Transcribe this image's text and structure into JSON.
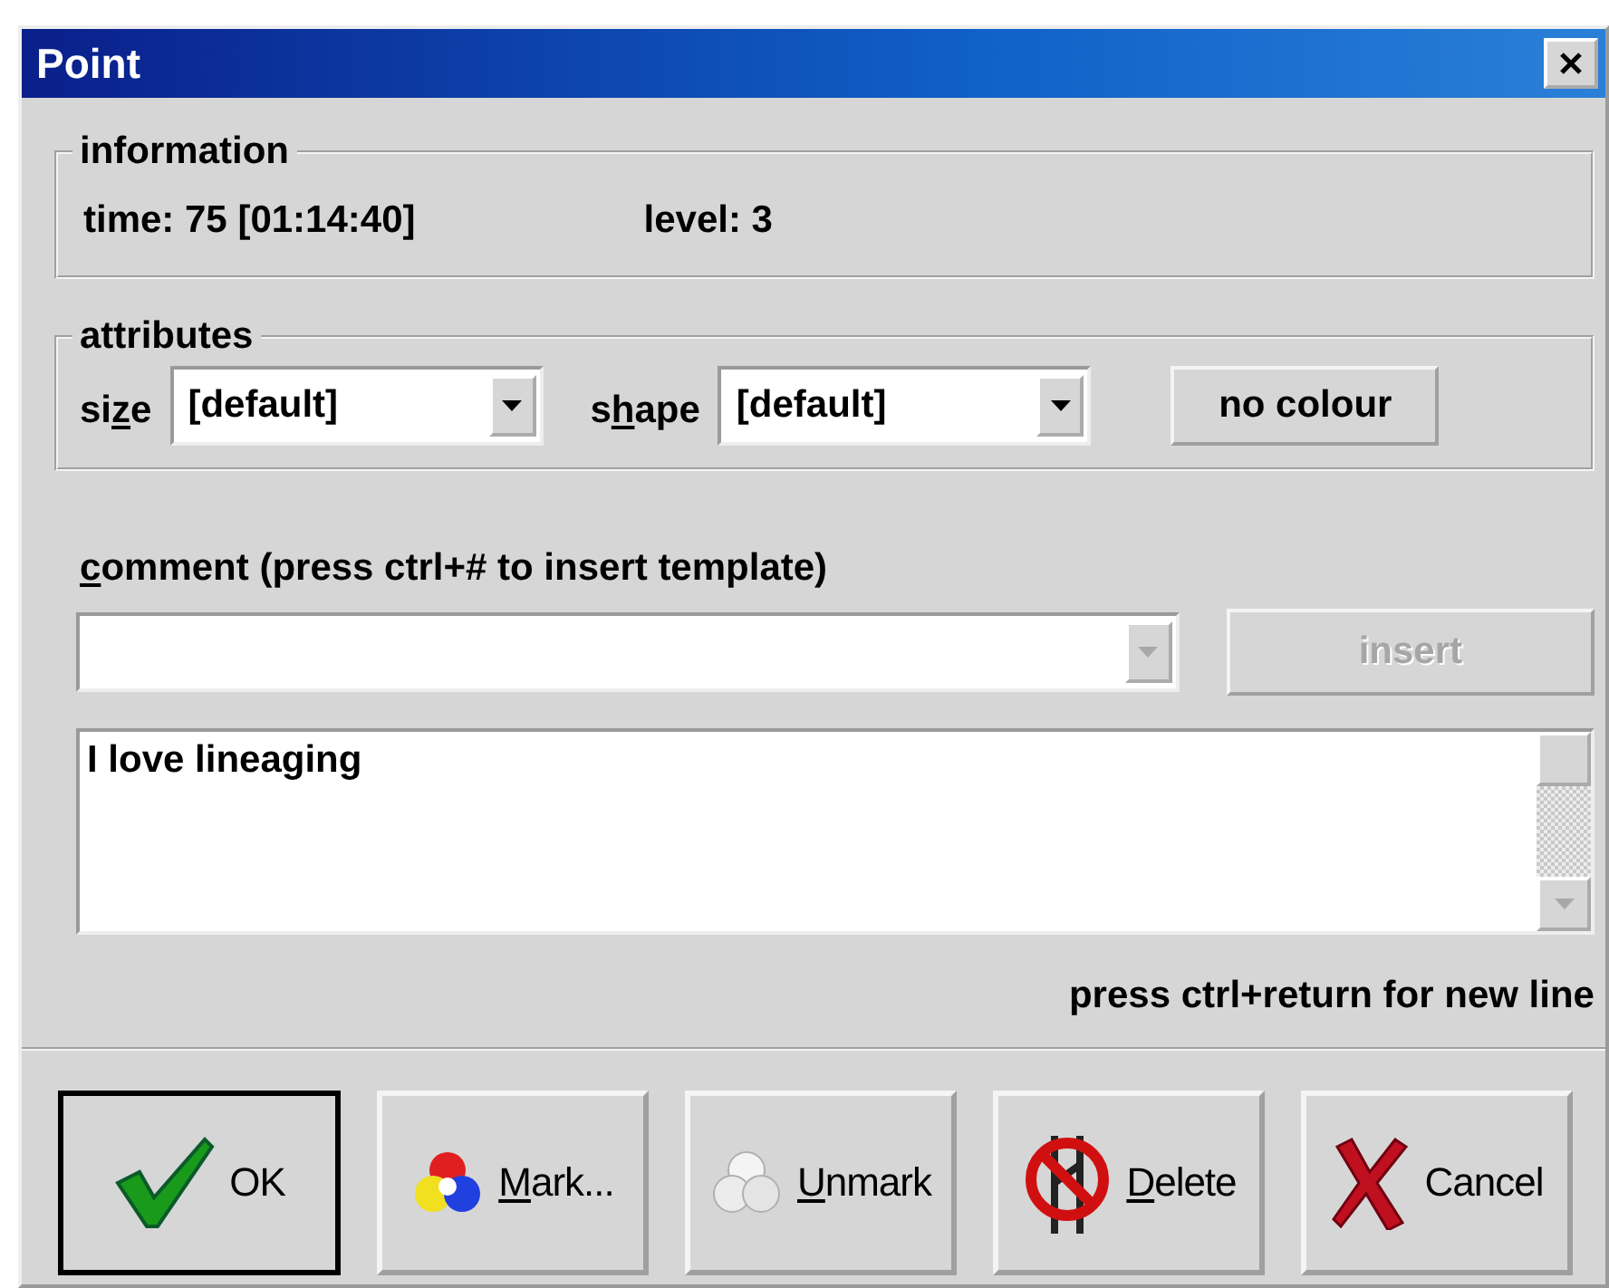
{
  "window": {
    "title": "Point"
  },
  "information": {
    "legend": "information",
    "fields": [
      "time: 75 [01:14:40]",
      "level: 3"
    ]
  },
  "attributes": {
    "legend": "attributes",
    "dropdowns": [
      {
        "label": {
          "pre": "si",
          "key": "z",
          "post": "e"
        },
        "value": "[default]"
      },
      {
        "label": {
          "pre": "s",
          "key": "h",
          "post": "ape"
        },
        "value": "[default]"
      }
    ],
    "colour_button": "no colour"
  },
  "comment": {
    "label": {
      "key": "c",
      "post": "omment (press ctrl+# to insert template)"
    },
    "template_disabled": true,
    "insert_button": {
      "label": "insert",
      "disabled": true
    },
    "text": "I love lineaging",
    "hint": "press ctrl+return for new line"
  },
  "buttons": [
    {
      "kind": "ok",
      "label": {
        "post": "OK"
      },
      "default": true
    },
    {
      "kind": "mark",
      "label": {
        "key": "M",
        "post": "ark..."
      },
      "default": false
    },
    {
      "kind": "unmark",
      "label": {
        "key": "U",
        "post": "nmark"
      },
      "default": false
    },
    {
      "kind": "delete",
      "label": {
        "key": "D",
        "post": "elete"
      },
      "default": false
    },
    {
      "kind": "cancel",
      "label": {
        "post": "Cancel"
      },
      "default": false
    }
  ]
}
